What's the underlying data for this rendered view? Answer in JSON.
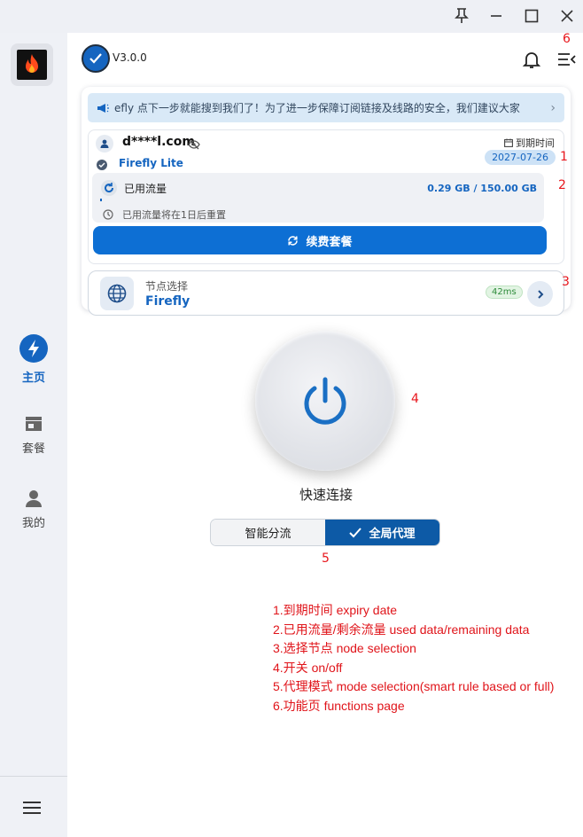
{
  "window": {
    "pin_icon": "pin-icon",
    "minimize_icon": "minimize-icon",
    "maximize_icon": "maximize-icon",
    "close_icon": "close-icon"
  },
  "sidebar": {
    "logo_icon": "flame-icon",
    "items": [
      {
        "label": "主页",
        "icon": "lightning-icon",
        "active": true
      },
      {
        "label": "套餐",
        "icon": "store-icon",
        "active": false
      },
      {
        "label": "我的",
        "icon": "person-icon",
        "active": false
      }
    ],
    "menu_icon": "hamburger-icon"
  },
  "header": {
    "version": "V3.0.0",
    "notification_icon": "bell-icon",
    "functions_icon": "menu-collapse-icon"
  },
  "notice": {
    "text": "efly 点下一步就能搜到我们了！为了进一步保障订阅链接及线路的安全，我们建议大家"
  },
  "account": {
    "email": "d****l.com",
    "plan": "Firefly Lite",
    "expiry_label": "到期时间",
    "expiry_date": "2027-07-26",
    "traffic_label": "已用流量",
    "traffic_value": "0.29 GB / 150.00 GB",
    "traffic_used_fraction": 0.002,
    "reset_text": "已用流量将在1日后重置",
    "renew_label": "续费套餐"
  },
  "node": {
    "label": "节点选择",
    "name": "Firefly",
    "latency": "42ms"
  },
  "connect": {
    "label": "快速连接"
  },
  "mode": {
    "options": [
      "智能分流",
      "全局代理"
    ],
    "selected": "全局代理"
  },
  "annotations": {
    "markers": [
      "1",
      "2",
      "3",
      "4",
      "5",
      "6"
    ],
    "legend": [
      "1.到期时间 expiry date",
      "2.已用流量/剩余流量 used data/remaining data",
      "3.选择节点 node selection",
      "4.开关 on/off",
      "5.代理模式 mode selection(smart rule based or full)",
      "6.功能页 functions page"
    ]
  },
  "colors": {
    "accent": "#1565c0",
    "button": "#0d6fd4",
    "annotation": "#e8161c"
  }
}
